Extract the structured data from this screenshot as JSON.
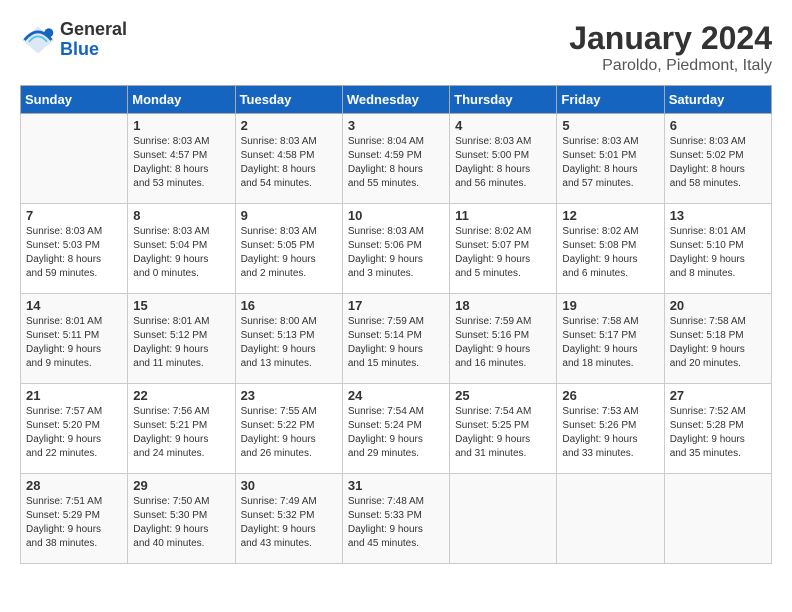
{
  "logo": {
    "general": "General",
    "blue": "Blue"
  },
  "title": {
    "month": "January 2024",
    "location": "Paroldo, Piedmont, Italy"
  },
  "headers": [
    "Sunday",
    "Monday",
    "Tuesday",
    "Wednesday",
    "Thursday",
    "Friday",
    "Saturday"
  ],
  "weeks": [
    [
      {
        "day": "",
        "info": ""
      },
      {
        "day": "1",
        "info": "Sunrise: 8:03 AM\nSunset: 4:57 PM\nDaylight: 8 hours\nand 53 minutes."
      },
      {
        "day": "2",
        "info": "Sunrise: 8:03 AM\nSunset: 4:58 PM\nDaylight: 8 hours\nand 54 minutes."
      },
      {
        "day": "3",
        "info": "Sunrise: 8:04 AM\nSunset: 4:59 PM\nDaylight: 8 hours\nand 55 minutes."
      },
      {
        "day": "4",
        "info": "Sunrise: 8:03 AM\nSunset: 5:00 PM\nDaylight: 8 hours\nand 56 minutes."
      },
      {
        "day": "5",
        "info": "Sunrise: 8:03 AM\nSunset: 5:01 PM\nDaylight: 8 hours\nand 57 minutes."
      },
      {
        "day": "6",
        "info": "Sunrise: 8:03 AM\nSunset: 5:02 PM\nDaylight: 8 hours\nand 58 minutes."
      }
    ],
    [
      {
        "day": "7",
        "info": "Sunrise: 8:03 AM\nSunset: 5:03 PM\nDaylight: 8 hours\nand 59 minutes."
      },
      {
        "day": "8",
        "info": "Sunrise: 8:03 AM\nSunset: 5:04 PM\nDaylight: 9 hours\nand 0 minutes."
      },
      {
        "day": "9",
        "info": "Sunrise: 8:03 AM\nSunset: 5:05 PM\nDaylight: 9 hours\nand 2 minutes."
      },
      {
        "day": "10",
        "info": "Sunrise: 8:03 AM\nSunset: 5:06 PM\nDaylight: 9 hours\nand 3 minutes."
      },
      {
        "day": "11",
        "info": "Sunrise: 8:02 AM\nSunset: 5:07 PM\nDaylight: 9 hours\nand 5 minutes."
      },
      {
        "day": "12",
        "info": "Sunrise: 8:02 AM\nSunset: 5:08 PM\nDaylight: 9 hours\nand 6 minutes."
      },
      {
        "day": "13",
        "info": "Sunrise: 8:01 AM\nSunset: 5:10 PM\nDaylight: 9 hours\nand 8 minutes."
      }
    ],
    [
      {
        "day": "14",
        "info": "Sunrise: 8:01 AM\nSunset: 5:11 PM\nDaylight: 9 hours\nand 9 minutes."
      },
      {
        "day": "15",
        "info": "Sunrise: 8:01 AM\nSunset: 5:12 PM\nDaylight: 9 hours\nand 11 minutes."
      },
      {
        "day": "16",
        "info": "Sunrise: 8:00 AM\nSunset: 5:13 PM\nDaylight: 9 hours\nand 13 minutes."
      },
      {
        "day": "17",
        "info": "Sunrise: 7:59 AM\nSunset: 5:14 PM\nDaylight: 9 hours\nand 15 minutes."
      },
      {
        "day": "18",
        "info": "Sunrise: 7:59 AM\nSunset: 5:16 PM\nDaylight: 9 hours\nand 16 minutes."
      },
      {
        "day": "19",
        "info": "Sunrise: 7:58 AM\nSunset: 5:17 PM\nDaylight: 9 hours\nand 18 minutes."
      },
      {
        "day": "20",
        "info": "Sunrise: 7:58 AM\nSunset: 5:18 PM\nDaylight: 9 hours\nand 20 minutes."
      }
    ],
    [
      {
        "day": "21",
        "info": "Sunrise: 7:57 AM\nSunset: 5:20 PM\nDaylight: 9 hours\nand 22 minutes."
      },
      {
        "day": "22",
        "info": "Sunrise: 7:56 AM\nSunset: 5:21 PM\nDaylight: 9 hours\nand 24 minutes."
      },
      {
        "day": "23",
        "info": "Sunrise: 7:55 AM\nSunset: 5:22 PM\nDaylight: 9 hours\nand 26 minutes."
      },
      {
        "day": "24",
        "info": "Sunrise: 7:54 AM\nSunset: 5:24 PM\nDaylight: 9 hours\nand 29 minutes."
      },
      {
        "day": "25",
        "info": "Sunrise: 7:54 AM\nSunset: 5:25 PM\nDaylight: 9 hours\nand 31 minutes."
      },
      {
        "day": "26",
        "info": "Sunrise: 7:53 AM\nSunset: 5:26 PM\nDaylight: 9 hours\nand 33 minutes."
      },
      {
        "day": "27",
        "info": "Sunrise: 7:52 AM\nSunset: 5:28 PM\nDaylight: 9 hours\nand 35 minutes."
      }
    ],
    [
      {
        "day": "28",
        "info": "Sunrise: 7:51 AM\nSunset: 5:29 PM\nDaylight: 9 hours\nand 38 minutes."
      },
      {
        "day": "29",
        "info": "Sunrise: 7:50 AM\nSunset: 5:30 PM\nDaylight: 9 hours\nand 40 minutes."
      },
      {
        "day": "30",
        "info": "Sunrise: 7:49 AM\nSunset: 5:32 PM\nDaylight: 9 hours\nand 43 minutes."
      },
      {
        "day": "31",
        "info": "Sunrise: 7:48 AM\nSunset: 5:33 PM\nDaylight: 9 hours\nand 45 minutes."
      },
      {
        "day": "",
        "info": ""
      },
      {
        "day": "",
        "info": ""
      },
      {
        "day": "",
        "info": ""
      }
    ]
  ]
}
